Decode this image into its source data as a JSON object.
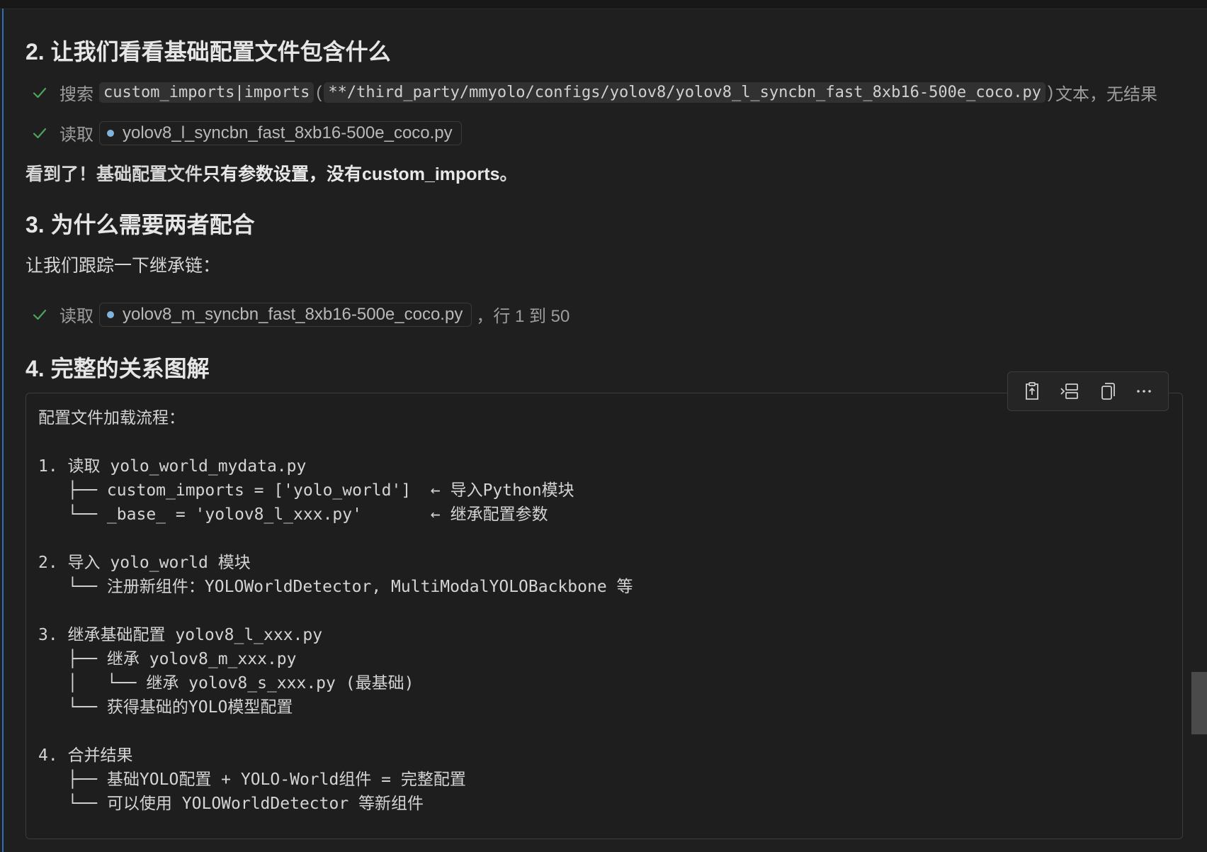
{
  "sections": {
    "s2_title": "2. 让我们看看基础配置文件包含什么",
    "s3_title": "3. 为什么需要两者配合",
    "s4_title": "4. 完整的关系图解"
  },
  "steps": {
    "search": {
      "verb": "搜索",
      "query": "custom_imports|imports",
      "path": "**/third_party/mmyolo/configs/yolov8/yolov8_l_syncbn_fast_8xb16-500e_coco.py",
      "tail": "文本，无结果"
    },
    "read1": {
      "verb": "读取",
      "file": "yolov8_l_syncbn_fast_8xb16-500e_coco.py"
    },
    "read2": {
      "verb": "读取",
      "file": "yolov8_m_syncbn_fast_8xb16-500e_coco.py",
      "tail": "，行 1 到 50"
    }
  },
  "paragraphs": {
    "p1_prefix": "看到了！基础配置文件",
    "p1_bold": "只有参数设置，没有custom_imports",
    "p1_suffix": "。",
    "p2": "让我们跟踪一下继承链："
  },
  "codeblock": {
    "text": "配置文件加载流程：\n\n1. 读取 yolo_world_mydata.py\n   ├── custom_imports = ['yolo_world']  ← 导入Python模块\n   └── _base_ = 'yolov8_l_xxx.py'       ← 继承配置参数\n\n2. 导入 yolo_world 模块\n   └── 注册新组件：YOLOWorldDetector, MultiModalYOLOBackbone 等\n\n3. 继承基础配置 yolov8_l_xxx.py\n   ├── 继承 yolov8_m_xxx.py\n   │   └── 继承 yolov8_s_xxx.py (最基础)\n   └── 获得基础的YOLO模型配置\n\n4. 合并结果\n   ├── 基础YOLO配置 + YOLO-World组件 = 完整配置\n   └── 可以使用 YOLOWorldDetector 等新组件"
  },
  "toolbar": {
    "icons": [
      "insert-at-cursor-icon",
      "insert-into-terminal-icon",
      "copy-icon",
      "more-actions-icon"
    ]
  },
  "colors": {
    "background": "#1f1f1f",
    "check": "#4fa35a",
    "accent": "#2f6fb6"
  }
}
